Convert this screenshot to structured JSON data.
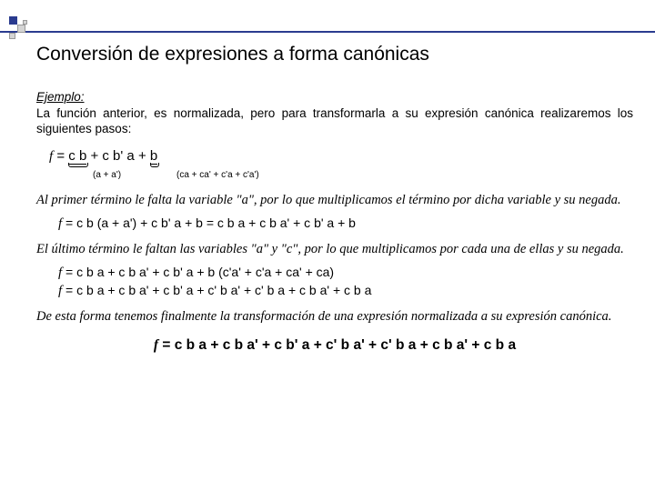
{
  "title": "Conversión de expresiones a forma canónicas",
  "example_label": "Ejemplo:",
  "intro": "La función anterior, es normalizada, pero para transformarla a su expresión canónica realizaremos los siguientes pasos:",
  "eq1_pre": " = ",
  "eq1_term1": "c b",
  "eq1_mid": " + c b' a + ",
  "eq1_term2": "b",
  "annot1": "(a + a')",
  "annot2": "(ca + ca' + c'a + c'a')",
  "explain1": "Al primer término le falta la variable \"a\", por lo que multiplicamos el término por dicha variable y su negada.",
  "eq2": " = c b (a + a') + c b' a + b    = c b a + c b a' + c b' a + b",
  "explain2": "El último término le faltan las variables \"a\" y \"c\", por lo que multiplicamos por cada una de ellas y su negada.",
  "eq3": " = c b a + c b a' + c b' a + b (c'a' + c'a + ca' + ca)",
  "eq4": " = c b a + c b a' + c b' a + c' b a' + c' b a + c b a' + c b a",
  "conclusion": "De esta forma tenemos finalmente la transformación de una expresión normalizada a su expresión canónica.",
  "final": " = c b a + c b a' + c b' a + c' b a' + c' b a + c b a' + c b a",
  "f": "f"
}
